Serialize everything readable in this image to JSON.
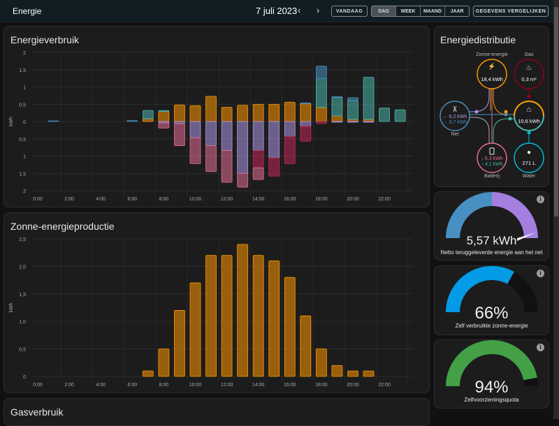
{
  "topbar": {
    "title": "Energie",
    "date": "7 juli 2023",
    "prev_icon": "chevron-left",
    "next_icon": "chevron-right",
    "today": "VANDAAG",
    "periods": [
      "DAG",
      "WEEK",
      "MAAND",
      "JAAR"
    ],
    "active_period": "DAG",
    "compare": "GEGEVENS VERGELIJKEN"
  },
  "colors": {
    "solar": "#ff9800",
    "battery_out": "#4db6ac",
    "grid_import": "#488fc2",
    "solar_to_battery": "#b097e8",
    "solar_to_grid": "#e46d96",
    "battery_to_grid": "#c3285a",
    "gas": "#8e021b",
    "water": "#00bcd4"
  },
  "chart_data": [
    {
      "type": "bar",
      "stacked": true,
      "title": "Energieverbruik",
      "ylabel": "kWh",
      "ylim": [
        -2,
        2
      ],
      "yticks": [
        "2",
        "1,5",
        "1",
        "0,5",
        "0",
        "0,5",
        "1",
        "1,5",
        "2"
      ],
      "xticks": [
        "0:00",
        "2:00",
        "4:00",
        "6:00",
        "8:00",
        "10:00",
        "12:00",
        "14:00",
        "16:00",
        "18:00",
        "20:00",
        "22:00"
      ],
      "categories": [
        0,
        1,
        2,
        3,
        4,
        5,
        6,
        7,
        8,
        9,
        10,
        11,
        12,
        13,
        14,
        15,
        16,
        17,
        18,
        19,
        20,
        21,
        22,
        23
      ],
      "series": [
        {
          "key": "solar",
          "values": [
            0,
            0,
            0,
            0,
            0,
            0,
            0,
            0.08,
            0.29,
            0.48,
            0.46,
            0.73,
            0.41,
            0.47,
            0.5,
            0.5,
            0.56,
            0.52,
            0.41,
            0.16,
            0.06,
            0.06,
            0,
            0
          ]
        },
        {
          "key": "battery_out",
          "values": [
            0,
            0,
            0,
            0,
            0,
            0,
            0,
            0.24,
            0.03,
            0,
            0,
            0,
            0,
            0,
            0,
            0,
            0,
            0,
            0.84,
            0.54,
            0.55,
            1.22,
            0.39,
            0.34
          ]
        },
        {
          "key": "grid_import",
          "values": [
            0.005,
            0.02,
            0,
            0,
            0,
            0,
            0.03,
            0.005,
            0,
            0,
            0,
            0,
            0,
            0,
            0,
            0,
            0,
            0.02,
            0.35,
            0.02,
            0.08,
            0,
            0,
            0
          ]
        },
        {
          "key": "solar_to_battery",
          "values": [
            0,
            0,
            0,
            0,
            0,
            0,
            0,
            0,
            -0.04,
            -0.06,
            -0.47,
            -0.7,
            -0.84,
            -1.5,
            -0.84,
            -1.05,
            -0.43,
            -0.14,
            0,
            -0.02,
            -0.02,
            -0.02,
            0,
            0
          ]
        },
        {
          "key": "battery_to_grid",
          "values": [
            0,
            0,
            0,
            0,
            0,
            0,
            0,
            0,
            0,
            0,
            0,
            0,
            0,
            0,
            -0.5,
            -0.53,
            -0.79,
            -0.43,
            -0.06,
            0,
            0,
            0,
            0,
            0
          ]
        },
        {
          "key": "solar_to_grid",
          "values": [
            0,
            0,
            0,
            0,
            0,
            0,
            0,
            0,
            -0.15,
            -0.64,
            -0.75,
            -0.75,
            -0.92,
            -0.4,
            -0.34,
            0,
            0,
            0,
            0,
            0,
            0,
            0,
            0,
            0
          ]
        }
      ]
    },
    {
      "type": "bar",
      "title": "Zonne-energieproductie",
      "ylabel": "kWh",
      "ylim": [
        0,
        2.5
      ],
      "yticks": [
        "2,5",
        "2,0",
        "1,5",
        "1,0",
        "0,5",
        "0"
      ],
      "xticks": [
        "0:00",
        "2:00",
        "4:00",
        "6:00",
        "8:00",
        "10:00",
        "12:00",
        "14:00",
        "16:00",
        "18:00",
        "20:00",
        "22:00"
      ],
      "categories": [
        0,
        1,
        2,
        3,
        4,
        5,
        6,
        7,
        8,
        9,
        10,
        11,
        12,
        13,
        14,
        15,
        16,
        17,
        18,
        19,
        20,
        21,
        22,
        23
      ],
      "values": [
        0,
        0,
        0,
        0,
        0,
        0,
        0,
        0.1,
        0.5,
        1.2,
        1.7,
        2.2,
        2.2,
        2.4,
        2.2,
        2.1,
        1.8,
        1.1,
        0.5,
        0.2,
        0.1,
        0.1,
        0,
        0
      ]
    }
  ],
  "gas_card": {
    "title": "Gasverbruik"
  },
  "distribution": {
    "title": "Energiedistributie",
    "solar": {
      "label": "Zonne-energie",
      "value": "18,4 kWh"
    },
    "gas": {
      "label": "Gas",
      "value": "0,3 m³"
    },
    "grid": {
      "label": "Net",
      "import": "← 6,2 kWh",
      "export": "→ 0,7 kWh"
    },
    "home": {
      "value": "10,6 kWh"
    },
    "battery": {
      "label": "Batterij",
      "in": "↓ 6,3 kWh",
      "out": "↑ 4,1 kWh"
    },
    "water": {
      "label": "Water",
      "value": "271 L"
    }
  },
  "gauges": [
    {
      "value": "5,57 kWh",
      "label": "Netto teruggeleverde energie aan het net",
      "fraction": 0.95
    },
    {
      "value": "66%",
      "label": "Zelf verbruikte zonne-energie",
      "fraction": 0.66
    },
    {
      "value": "94%",
      "label": "Zelfvoorzieningsquota",
      "fraction": 0.94
    }
  ]
}
